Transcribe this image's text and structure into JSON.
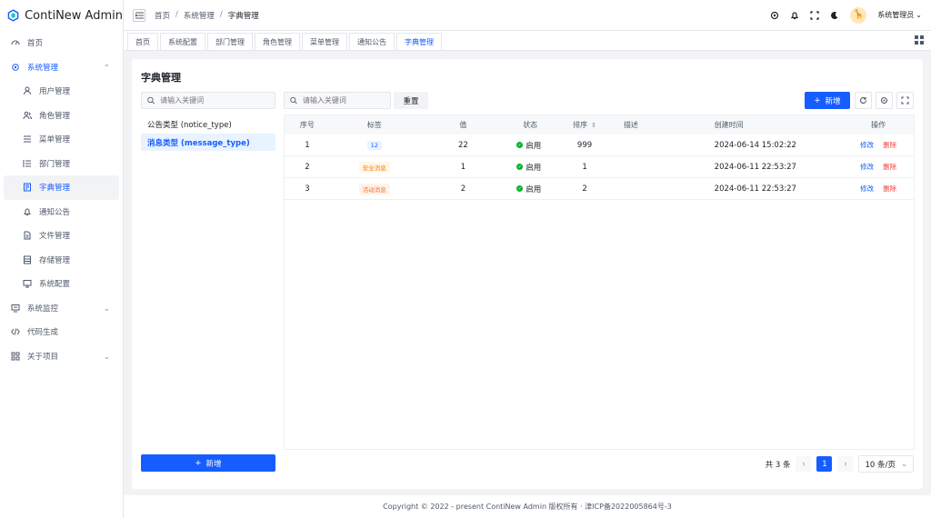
{
  "app": {
    "title": "ContiNew Admin"
  },
  "sidebar": {
    "items": [
      {
        "label": "首页",
        "icon": "dashboard-icon"
      },
      {
        "label": "系统管理",
        "icon": "settings-icon"
      },
      {
        "label": "用户管理",
        "icon": "user-icon"
      },
      {
        "label": "角色管理",
        "icon": "user-group-icon"
      },
      {
        "label": "菜单管理",
        "icon": "menu-icon"
      },
      {
        "label": "部门管理",
        "icon": "dept-icon"
      },
      {
        "label": "字典管理",
        "icon": "dict-icon"
      },
      {
        "label": "通知公告",
        "icon": "notification-icon"
      },
      {
        "label": "文件管理",
        "icon": "file-icon"
      },
      {
        "label": "存储管理",
        "icon": "storage-icon"
      },
      {
        "label": "系统配置",
        "icon": "desktop-icon"
      },
      {
        "label": "系统监控",
        "icon": "monitor-icon"
      },
      {
        "label": "代码生成",
        "icon": "code-icon"
      },
      {
        "label": "关于项目",
        "icon": "apps-icon"
      }
    ]
  },
  "header": {
    "breadcrumb": [
      "首页",
      "系统管理",
      "字典管理"
    ],
    "sep": "/",
    "user": "系统管理员",
    "avatar": "🦒"
  },
  "tabs": [
    "首页",
    "系统配置",
    "部门管理",
    "角色管理",
    "菜单管理",
    "通知公告",
    "字典管理"
  ],
  "page": {
    "title": "字典管理",
    "left_search_placeholder": "请输入关键词",
    "tree": [
      "公告类型 (notice_type)",
      "消息类型 (message_type)"
    ],
    "right_search_placeholder": "请输入关键词",
    "reset": "重置",
    "add": "新增",
    "add_bottom": "新增"
  },
  "table": {
    "headers": [
      "序号",
      "标签",
      "值",
      "状态",
      "排序",
      "描述",
      "创建时间",
      "操作"
    ],
    "rows": [
      {
        "no": "1",
        "label": "12",
        "label_color": "#165dff",
        "label_bg": "#e8f3ff",
        "value": "22",
        "status": "启用",
        "sort": "999",
        "desc": "",
        "time": "2024-06-14 15:02:22",
        "edit": "修改",
        "del": "删除"
      },
      {
        "no": "2",
        "label": "安全消息",
        "label_color": "#ff7d00",
        "label_bg": "#fff7e8",
        "value": "1",
        "status": "启用",
        "sort": "1",
        "desc": "",
        "time": "2024-06-11 22:53:27",
        "edit": "修改",
        "del": "删除"
      },
      {
        "no": "3",
        "label": "活动消息",
        "label_color": "#f77234",
        "label_bg": "#fff3e8",
        "value": "2",
        "status": "启用",
        "sort": "2",
        "desc": "",
        "time": "2024-06-11 22:53:27",
        "edit": "修改",
        "del": "删除"
      }
    ]
  },
  "pagination": {
    "total": "共 3 条",
    "current": "1",
    "size": "10 条/页"
  },
  "footer": {
    "text": "Copyright © 2022 - present ContiNew Admin 版权所有 · 津ICP备2022005864号-3"
  },
  "colors": {
    "primary": "#165dff",
    "success": "#00b42a",
    "danger": "#f53f3f"
  }
}
